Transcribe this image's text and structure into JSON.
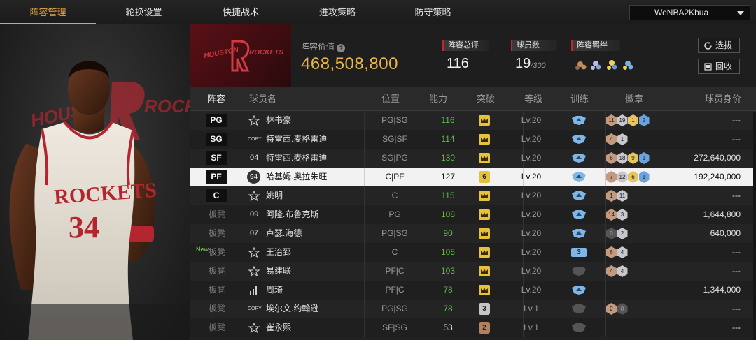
{
  "tabs": [
    {
      "label": "阵容管理",
      "active": true
    },
    {
      "label": "轮换设置",
      "active": false
    },
    {
      "label": "快捷战术",
      "active": false
    },
    {
      "label": "进攻策略",
      "active": false
    },
    {
      "label": "防守策略",
      "active": false
    }
  ],
  "account": {
    "name": "WeNBA2Khua"
  },
  "team": {
    "logo_text_1": "HOUSTON",
    "logo_text_2": "ROCKETS",
    "art_logo_text_1": "HOUST",
    "art_logo_text_2": "ROCK",
    "jersey_team": "ROCKETS",
    "jersey_number": "34"
  },
  "lineup_value": {
    "label": "阵容价值",
    "value": "468,508,800"
  },
  "stats": {
    "rating_label": "阵容总评",
    "rating_value": "116",
    "players_label": "球员数",
    "players_value": "19",
    "players_max": "/300",
    "chem_label": "阵容羁绊"
  },
  "buttons": {
    "filter": "选拔",
    "recycle": "回收"
  },
  "columns": [
    "阵容",
    "球员名",
    "位置",
    "能力",
    "突破",
    "等级",
    "训练",
    "徽章",
    "球员身价"
  ],
  "rows": [
    {
      "slot": "PG",
      "starter": true,
      "tag": "star",
      "name": "林书豪",
      "pos": "PG|SG",
      "ability": "116",
      "green": true,
      "breakthrough": "crown",
      "level": "Lv.20",
      "train": "blue",
      "badges": [
        [
          "b-brz",
          "11"
        ],
        [
          "b-sil",
          "19"
        ],
        [
          "b-gld",
          "1"
        ],
        [
          "b-blu",
          "2"
        ]
      ],
      "value": "---"
    },
    {
      "slot": "SG",
      "starter": true,
      "tag": "COPY",
      "name": "特雷西.麦格雷迪",
      "pos": "SG|SF",
      "ability": "114",
      "green": true,
      "breakthrough": "crown",
      "level": "Lv.20",
      "train": "blue",
      "badges": [
        [
          "b-brz",
          "4"
        ],
        [
          "b-sil",
          "1"
        ]
      ],
      "value": "---"
    },
    {
      "slot": "SF",
      "starter": true,
      "tag": "04",
      "name": "特雷西.麦格雷迪",
      "pos": "SG|PG",
      "ability": "130",
      "green": true,
      "breakthrough": "crown",
      "level": "Lv.20",
      "train": "blue",
      "badges": [
        [
          "b-brz",
          "6"
        ],
        [
          "b-sil",
          "18"
        ],
        [
          "b-gld",
          "9"
        ],
        [
          "b-blu",
          "1"
        ]
      ],
      "value": "272,640,000"
    },
    {
      "slot": "PF",
      "starter": true,
      "selected": true,
      "tag": "94",
      "name": "哈基姆.奥拉朱旺",
      "pos": "C|PF",
      "ability": "127",
      "green": false,
      "breakthrough": "6",
      "level": "Lv.20",
      "train": "blue",
      "badges": [
        [
          "b-brz",
          "7"
        ],
        [
          "b-sil",
          "12"
        ],
        [
          "b-gld",
          "6"
        ],
        [
          "b-blu",
          "1"
        ]
      ],
      "value": "192,240,000"
    },
    {
      "slot": "C",
      "starter": true,
      "tag": "star",
      "name": "姚明",
      "pos": "C",
      "ability": "115",
      "green": true,
      "breakthrough": "crown",
      "level": "Lv.20",
      "train": "blue",
      "badges": [
        [
          "b-brz",
          "1"
        ],
        [
          "b-sil",
          "11"
        ]
      ],
      "value": "---"
    },
    {
      "slot": "板凳",
      "starter": false,
      "tag": "09",
      "name": "阿隆.布鲁克斯",
      "pos": "PG",
      "ability": "108",
      "green": true,
      "breakthrough": "crown",
      "level": "Lv.20",
      "train": "blue",
      "badges": [
        [
          "b-brz",
          "14"
        ],
        [
          "b-sil",
          "3"
        ]
      ],
      "value": "1,644,800"
    },
    {
      "slot": "板凳",
      "starter": false,
      "tag": "07",
      "name": "卢瑟.海德",
      "pos": "PG|SG",
      "ability": "90",
      "green": true,
      "breakthrough": "crown",
      "level": "Lv.20",
      "train": "blue",
      "badges": [
        [
          "b-dk",
          "0"
        ],
        [
          "b-sil",
          "2"
        ]
      ],
      "value": "640,000"
    },
    {
      "slot": "板凳",
      "starter": false,
      "new": "New",
      "tag": "star",
      "name": "王治郅",
      "pos": "C",
      "ability": "105",
      "green": true,
      "breakthrough": "crown",
      "level": "Lv.20",
      "train": "3",
      "badges": [
        [
          "b-brz",
          "6"
        ],
        [
          "b-sil",
          "4"
        ]
      ],
      "value": "---"
    },
    {
      "slot": "板凳",
      "starter": false,
      "tag": "star",
      "name": "易建联",
      "pos": "PF|C",
      "ability": "103",
      "green": true,
      "breakthrough": "crown",
      "level": "Lv.20",
      "train": "gray",
      "badges": [
        [
          "b-brz",
          "4"
        ],
        [
          "b-sil",
          "4"
        ]
      ],
      "value": "---"
    },
    {
      "slot": "板凳",
      "starter": false,
      "tag": "bars",
      "name": "周琦",
      "pos": "PF|C",
      "ability": "78",
      "green": true,
      "breakthrough": "crown",
      "level": "Lv.20",
      "train": "blue",
      "badges": [],
      "value": "1,344,000"
    },
    {
      "slot": "板凳",
      "starter": false,
      "tag": "COPY",
      "name": "埃尔文.约翰逊",
      "pos": "PG|SG",
      "ability": "78",
      "green": true,
      "breakthrough": "3",
      "level": "Lv.1",
      "train": "gray",
      "badges": [
        [
          "b-brz",
          "2"
        ],
        [
          "b-dk",
          "0"
        ]
      ],
      "value": "---"
    },
    {
      "slot": "板凳",
      "starter": false,
      "tag": "star",
      "name": "崔永熙",
      "pos": "SF|SG",
      "ability": "53",
      "green": false,
      "breakthrough": "2",
      "level": "Lv.1",
      "train": "gray",
      "badges": [],
      "value": "---"
    }
  ]
}
